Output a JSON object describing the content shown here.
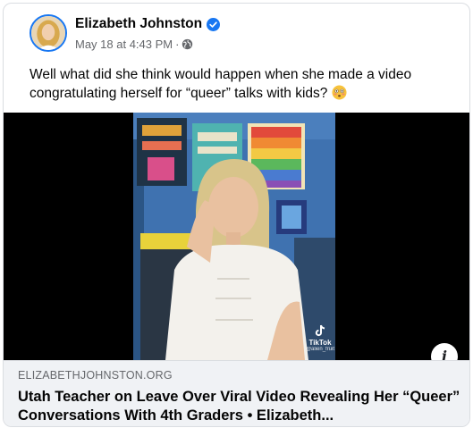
{
  "post": {
    "author": "Elizabeth Johnston",
    "verified": true,
    "timestamp": "May 18 at 4:43 PM",
    "separator": "·",
    "audience_icon": "globe-icon",
    "text": "Well what did she think would happen when she made a video congratulating herself for “queer” talks with kids?",
    "emoji": "flushed-face-emoji"
  },
  "video": {
    "watermark": {
      "brand": "TikTok",
      "handle": "@alien_fruit"
    },
    "info_button_label": "i"
  },
  "link_preview": {
    "domain": "ELIZABETHJOHNSTON.ORG",
    "title": "Utah Teacher on Leave Over Viral Video Revealing Her “Queer” Conversations With 4th Graders • Elizabeth..."
  },
  "colors": {
    "verified_badge": "#1877f2",
    "meta_text": "#65676b",
    "preview_bg": "#f0f2f5",
    "video_bg": "#000000"
  }
}
